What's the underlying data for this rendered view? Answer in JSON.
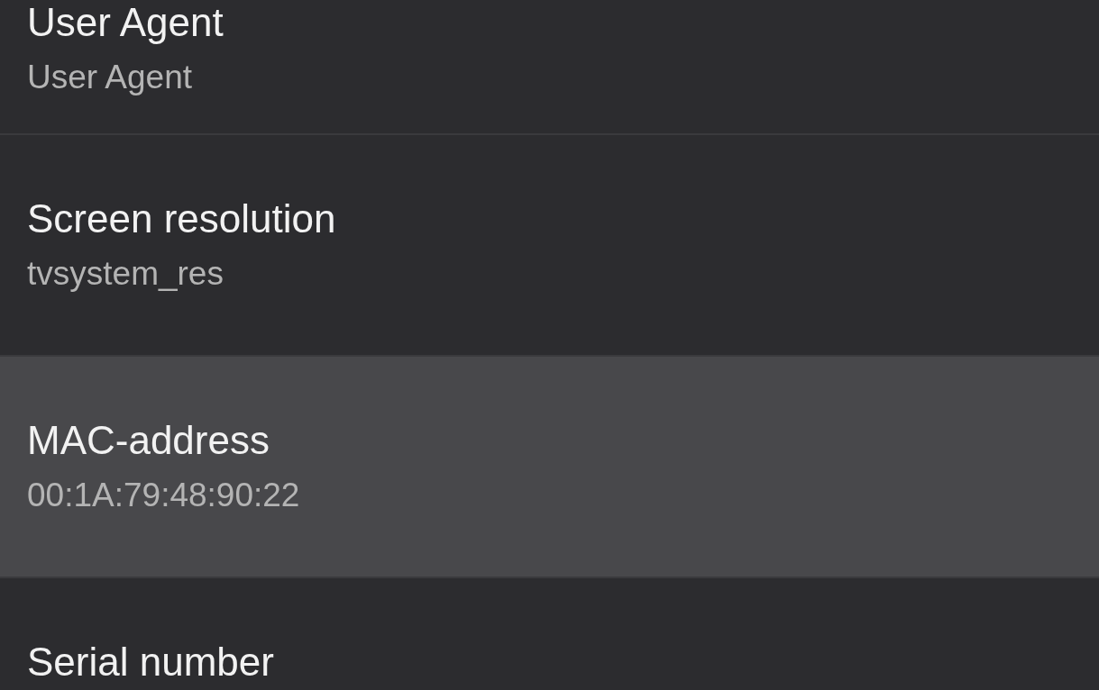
{
  "settings_items": [
    {
      "title": "User Agent",
      "value": "User Agent",
      "selected": false
    },
    {
      "title": "Screen resolution",
      "value": "tvsystem_res",
      "selected": false
    },
    {
      "title": "MAC-address",
      "value": "00:1A:79:48:90:22",
      "selected": true
    },
    {
      "title": "Serial number",
      "selected": false
    }
  ]
}
